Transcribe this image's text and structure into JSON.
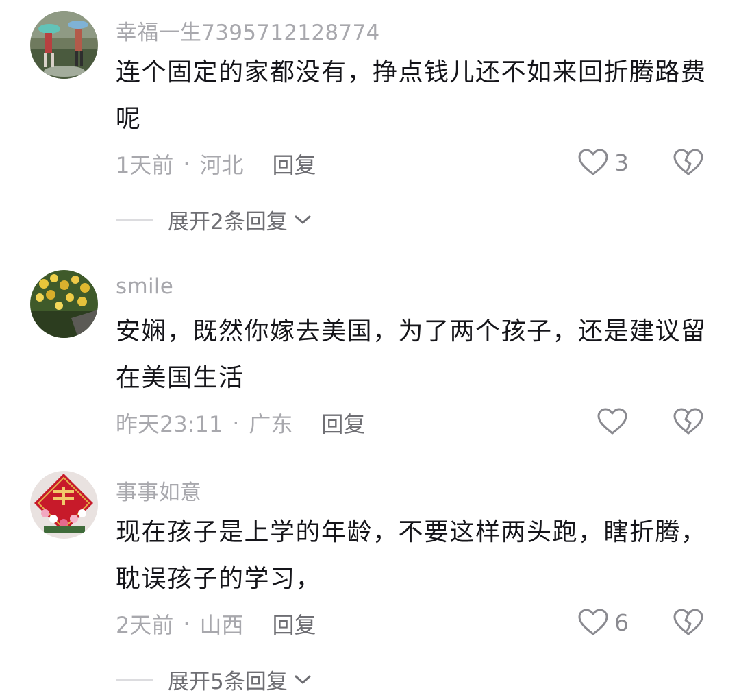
{
  "colors": {
    "text_primary": "#15151a",
    "text_secondary": "#a8a8ad",
    "reply": "#6e6e73"
  },
  "comments": [
    {
      "username": "幸福一生7395712128774",
      "text": "连个固定的家都没有，挣点钱儿还不如来回折腾路费呢",
      "time": "1天前",
      "location": "河北",
      "reply_label": "回复",
      "likes": "3",
      "avatar_icon": "umbrella-photo",
      "expand_label": "展开2条回复"
    },
    {
      "username": "smile",
      "text": "安娴，既然你嫁去美国，为了两个孩子，还是建议留在美国生活",
      "time": "昨天23:11",
      "location": "广东",
      "reply_label": "回复",
      "likes": "",
      "avatar_icon": "orchid-photo"
    },
    {
      "username": "事事如意",
      "text": "现在孩子是上学的年龄，不要这样两头跑，瞎折腾，耽误孩子的学习，",
      "time": "2天前",
      "location": "山西",
      "reply_label": "回复",
      "likes": "6",
      "avatar_icon": "double-happiness-photo",
      "expand_label": "展开5条回复"
    }
  ],
  "separator": "·"
}
